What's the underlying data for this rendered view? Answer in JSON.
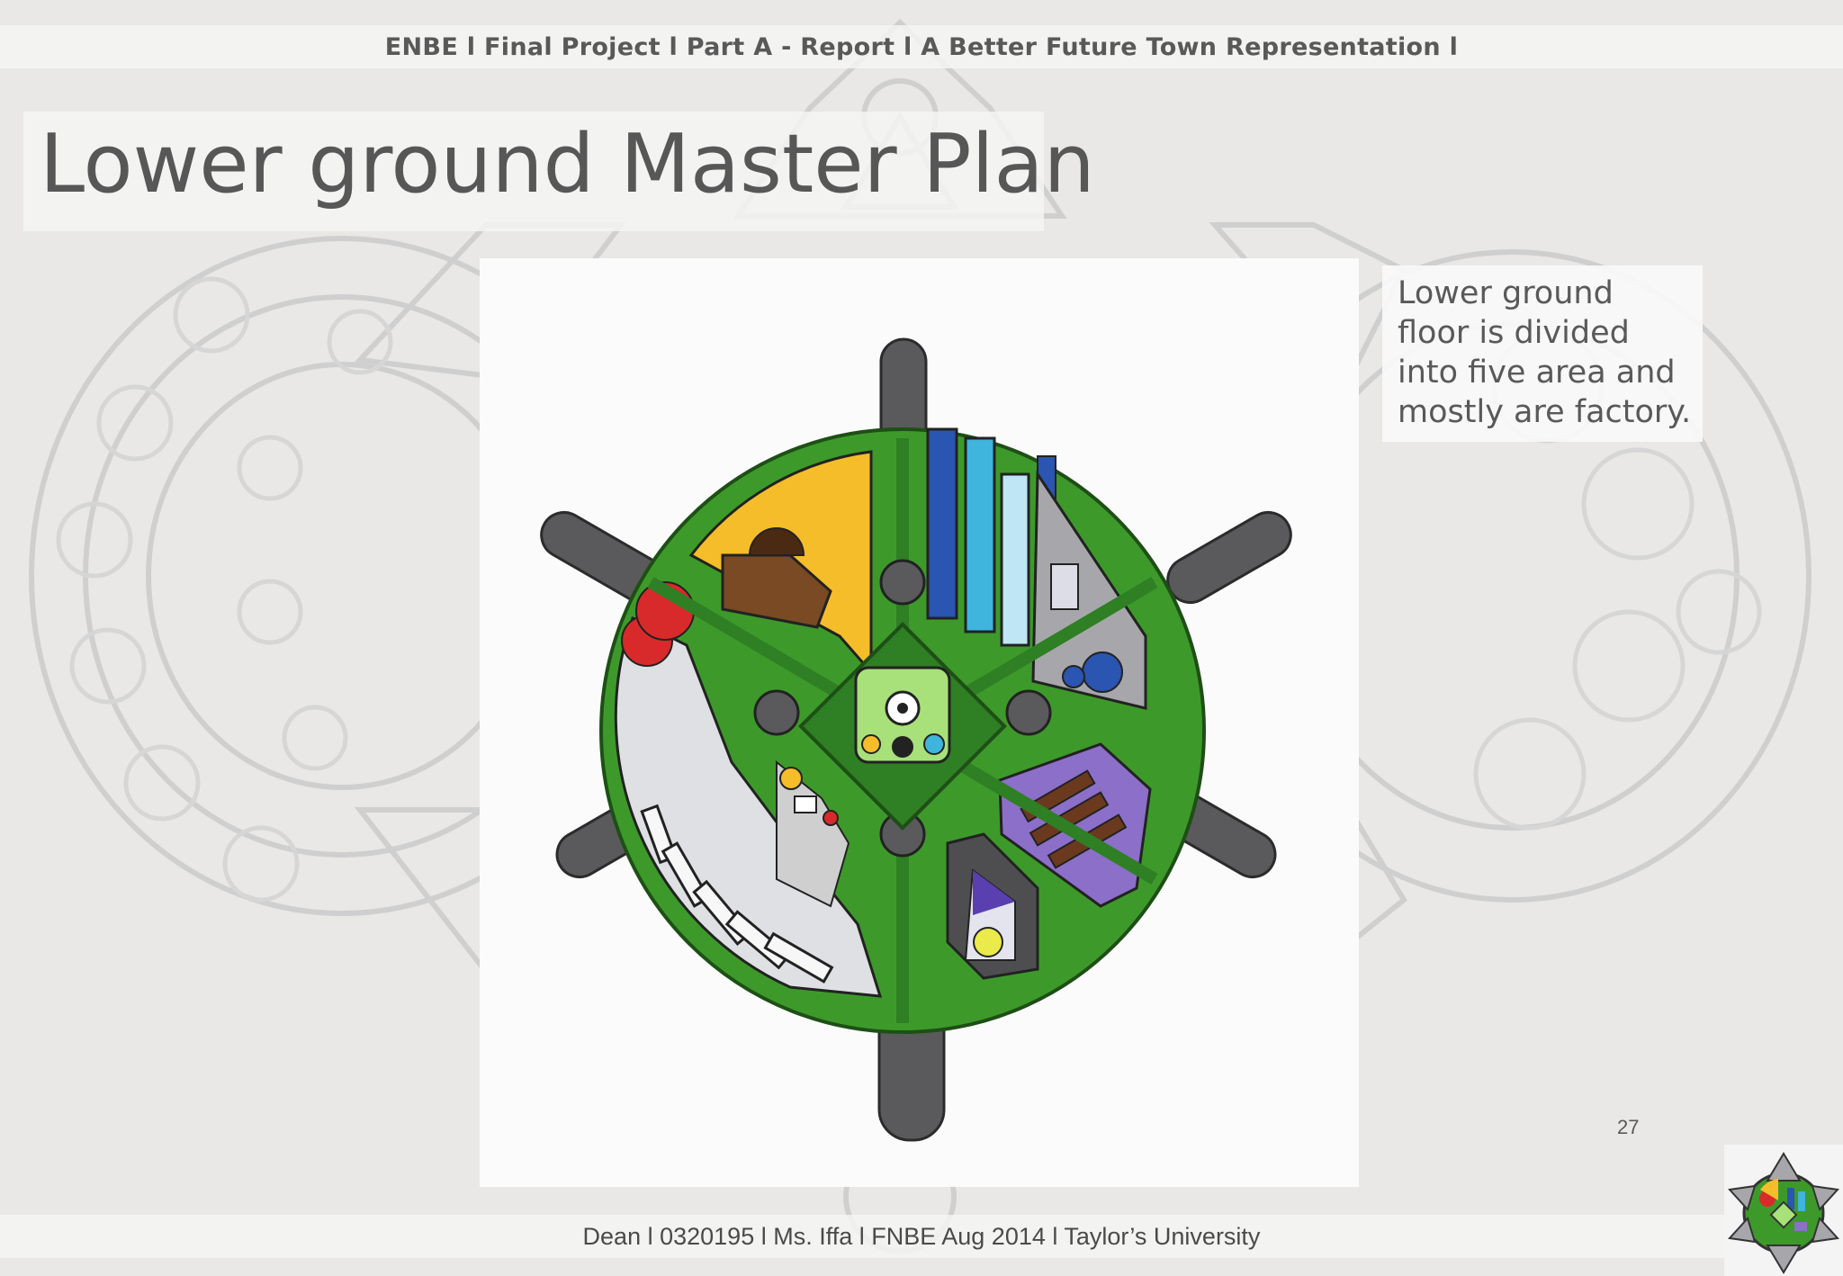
{
  "header": {
    "text": "ENBE l Final Project l Part A - Report l A Better Future Town Representation  l"
  },
  "slide": {
    "title": "Lower ground Master Plan",
    "description": "Lower ground floor is divided into five area and mostly are factory.",
    "page_number": "27"
  },
  "footer": {
    "text": "Dean l 0320195 l Ms. Iffa l FNBE Aug 2014 l Taylor’s University"
  },
  "colors": {
    "ring_green": "#3d9a2a",
    "center_green": "#2f7f24",
    "pillar_gray": "#5a5a5c",
    "yellow_zone": "#f5bd2a",
    "purple_zone": "#8c6fc9",
    "blue_stripe": "#2a55b0",
    "cyan_stripe": "#3fb4dc",
    "light_blue_stripe": "#bfe6f4",
    "red_dome": "#d82a2a",
    "brown_block": "#7a4a24",
    "text_gray": "#595959"
  },
  "icons": {
    "logo": "town-plan-logo"
  }
}
